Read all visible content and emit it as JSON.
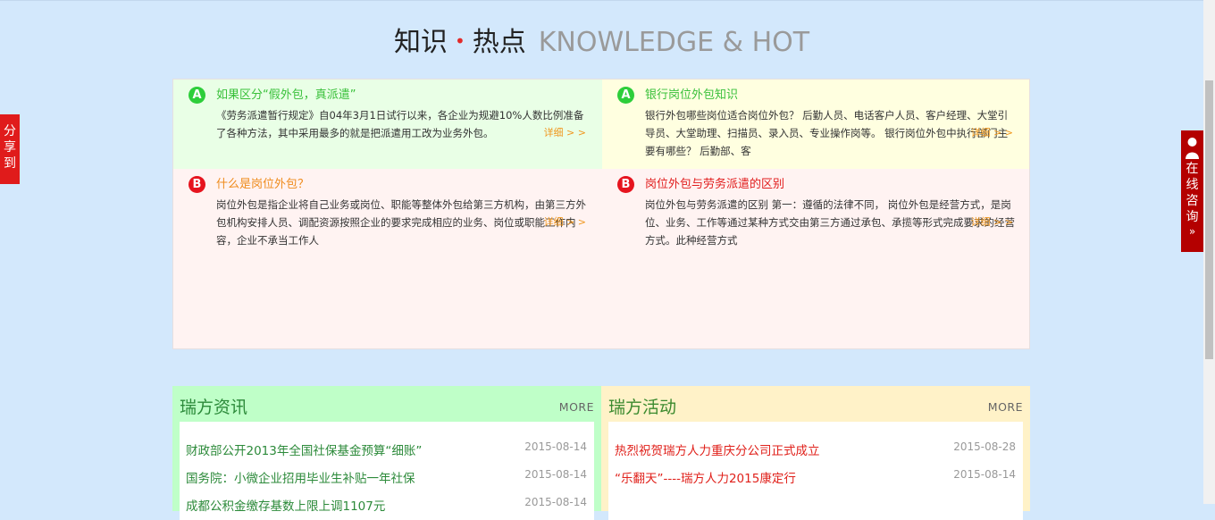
{
  "section": {
    "title_cn_1": "知识",
    "dot": "•",
    "title_cn_2": "热点",
    "title_en": "KNOWLEDGE & HOT"
  },
  "knowledge": [
    {
      "badge": "A",
      "title": "如果区分“假外包，真派遣”",
      "body": "《劳务派遣暂行规定》自04年3月1日试行以来，各企业为规避10%人数比例准备了各种方法，其中采用最多的就是把派遣用工改为业务外包。",
      "more": "详细 > >"
    },
    {
      "badge": "A",
      "title": "银行岗位外包知识",
      "body": "银行外包哪些岗位适合岗位外包？ 后勤人员、电话客户人员、客户经理、大堂引导员、大堂助理、扫描员、录入员、专业操作岗等。 银行岗位外包中执行部门主要有哪些？ 后勤部、客",
      "more": "详细 > >"
    },
    {
      "badge": "B",
      "title": "什么是岗位外包？",
      "body": "岗位外包是指企业将自己业务或岗位、职能等整体外包给第三方机构，由第三方外包机构安排人员、调配资源按照企业的要求完成相应的业务、岗位或职能工作内容，企业不承当工作人",
      "more": "详细 > >"
    },
    {
      "badge": "B",
      "title": "岗位外包与劳务派遣的区别",
      "body": "岗位外包与劳务派遣的区别 第一：遵循的法律不同， 岗位外包是经营方式，是岗位、业务、工作等通过某种方式交由第三方通过承包、承揽等形式完成要求的经营方式。此种经营方式",
      "more": "详细 > >"
    }
  ],
  "news": {
    "title": "瑞方资讯",
    "more": "MORE",
    "items": [
      {
        "title": "财政部公开2013年全国社保基金预算“细账”",
        "date": "2015-08-14"
      },
      {
        "title": "国务院：小微企业招用毕业生补贴一年社保",
        "date": "2015-08-14"
      },
      {
        "title": "成都公积金缴存基数上限上调1107元",
        "date": "2015-08-14"
      }
    ]
  },
  "activities": {
    "title": "瑞方活动",
    "more": "MORE",
    "items": [
      {
        "title": "热烈祝贺瑞方人力重庆分公司正式成立",
        "date": "2015-08-28"
      },
      {
        "title": "“乐翻天”----瑞方人力2015康定行",
        "date": "2015-08-14"
      }
    ]
  },
  "sidebar": {
    "share_label": "分享到",
    "consult_label": "在线咨询",
    "consult_arrow": "»"
  },
  "colors": {
    "background": "#d3e8fc",
    "share_tab": "#e01b1b",
    "consult_tab": "#b40000"
  }
}
